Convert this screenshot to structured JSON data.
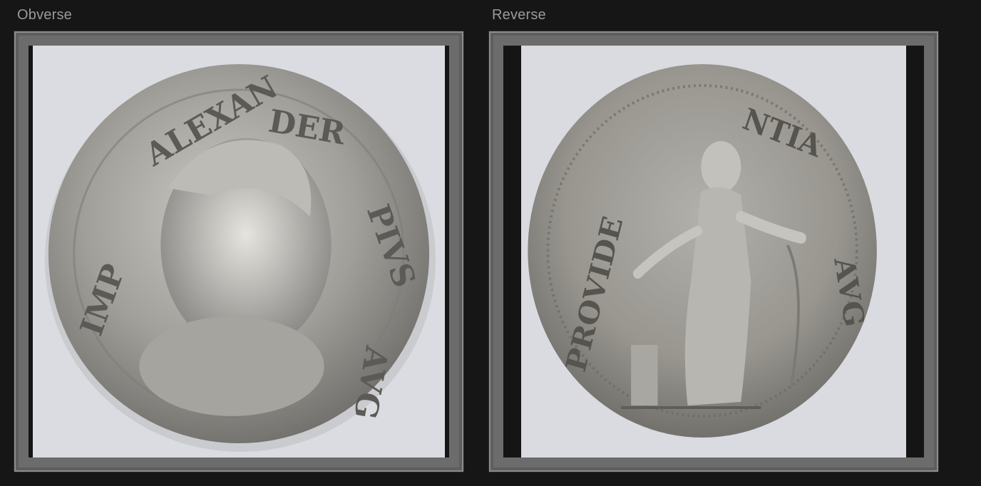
{
  "panels": [
    {
      "label": "Obverse",
      "icon": "coin-obverse-photo"
    },
    {
      "label": "Reverse",
      "icon": "coin-reverse-photo"
    }
  ],
  "colors": {
    "background": "#161616",
    "frame": "#6c6c6c",
    "label": "#9a9a9a",
    "photo_backdrop": "#d9dbe0",
    "coin_silver": "#9d9b97"
  }
}
